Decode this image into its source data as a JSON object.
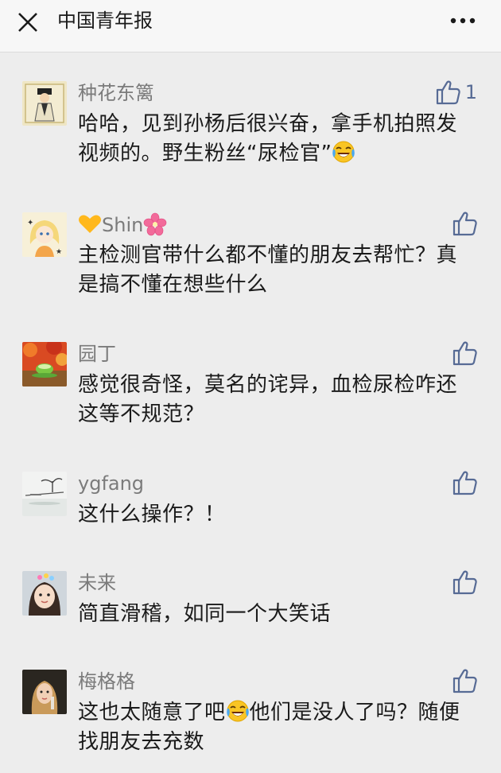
{
  "header": {
    "title": "中国青年报",
    "close_icon": "close-icon",
    "more_icon": "more-dots-icon"
  },
  "colors": {
    "link_blue": "#576b95",
    "name_gray": "#7b7b7b",
    "background": "#ededed"
  },
  "comments": [
    {
      "name": "种花东篱",
      "text_before": "哈哈，见到孙杨后很兴奋，拿手机拍照发视频的。野生粉丝“尿检官”",
      "text_after": "",
      "emoji": "laughing-crying-emoji",
      "likes": "1"
    },
    {
      "name": "Shin",
      "name_prefix_icon": "yellow-heart-icon",
      "name_suffix_icon": "cherry-blossom-icon",
      "text": "主检测官带什么都不懂的朋友去帮忙？真是搞不懂在想些什么"
    },
    {
      "name": "园丁",
      "text": "感觉很奇怪，莫名的诧异，血检尿检咋还这等不规范？"
    },
    {
      "name": "ygfang",
      "text": "这什么操作？！"
    },
    {
      "name": "未来",
      "text": "简直滑稽，如同一个大笑话"
    },
    {
      "name": "梅格格",
      "text_before": "这也太随意了吧",
      "emoji": "laughing-crying-emoji",
      "text_after": "他们是没人了吗？随便找朋友去充数"
    }
  ]
}
